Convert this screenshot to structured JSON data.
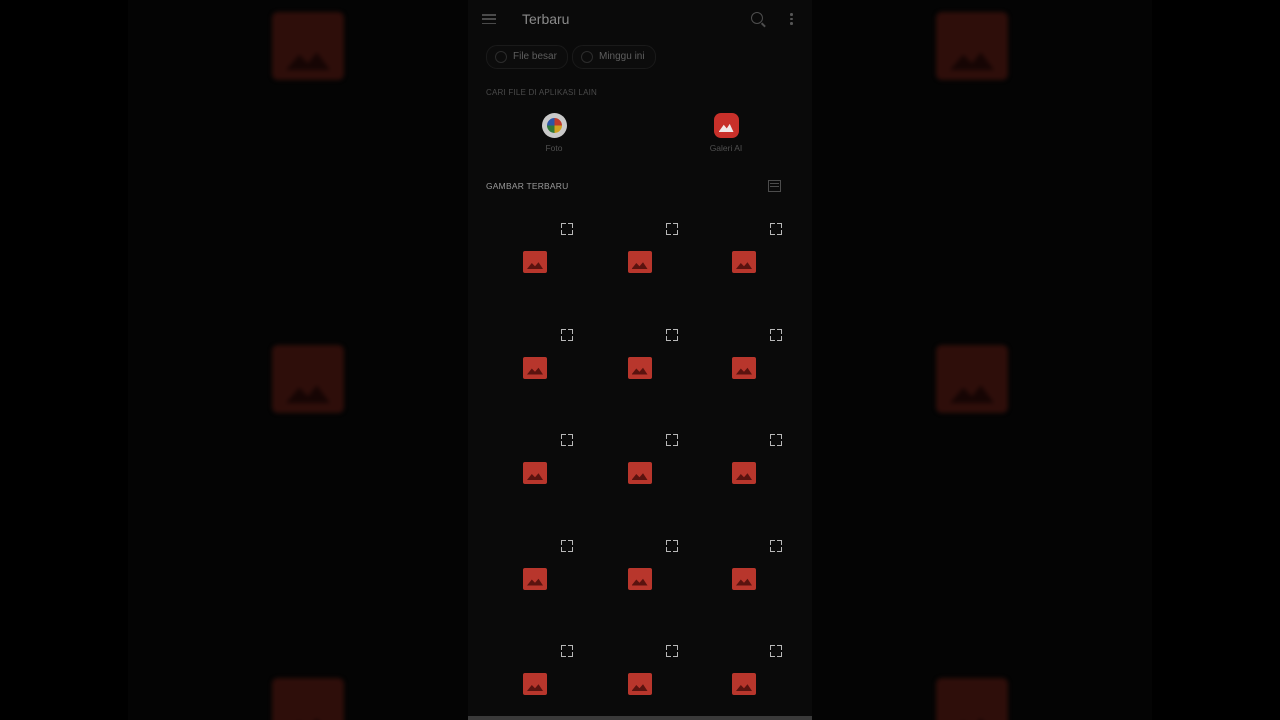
{
  "app": {
    "title": "Terbaru"
  },
  "toolbar": {
    "menu_icon": "menu-icon",
    "search_icon": "search-icon",
    "more_icon": "more-vert-icon"
  },
  "filters": [
    {
      "label": "File besar",
      "icon": "file-icon"
    },
    {
      "label": "Minggu ini",
      "icon": "clock-icon"
    }
  ],
  "other_apps": {
    "section_label": "CARI FILE DI APLIKASI LAIN",
    "apps": [
      {
        "name": "Foto",
        "icon": "photos-pinwheel-icon"
      },
      {
        "name": "Galeri AI",
        "icon": "gallery-icon"
      }
    ]
  },
  "recent_images": {
    "section_label": "GAMBAR TERBARU",
    "view_toggle_icon": "list-view-icon",
    "rows": 5,
    "columns": 3,
    "placeholder_icon": "image-placeholder-icon",
    "expand_icon": "expand-icon"
  },
  "colors": {
    "placeholder_red": "#b8362c",
    "gallery_red": "#c8302a",
    "background": "#0a0a0a"
  }
}
